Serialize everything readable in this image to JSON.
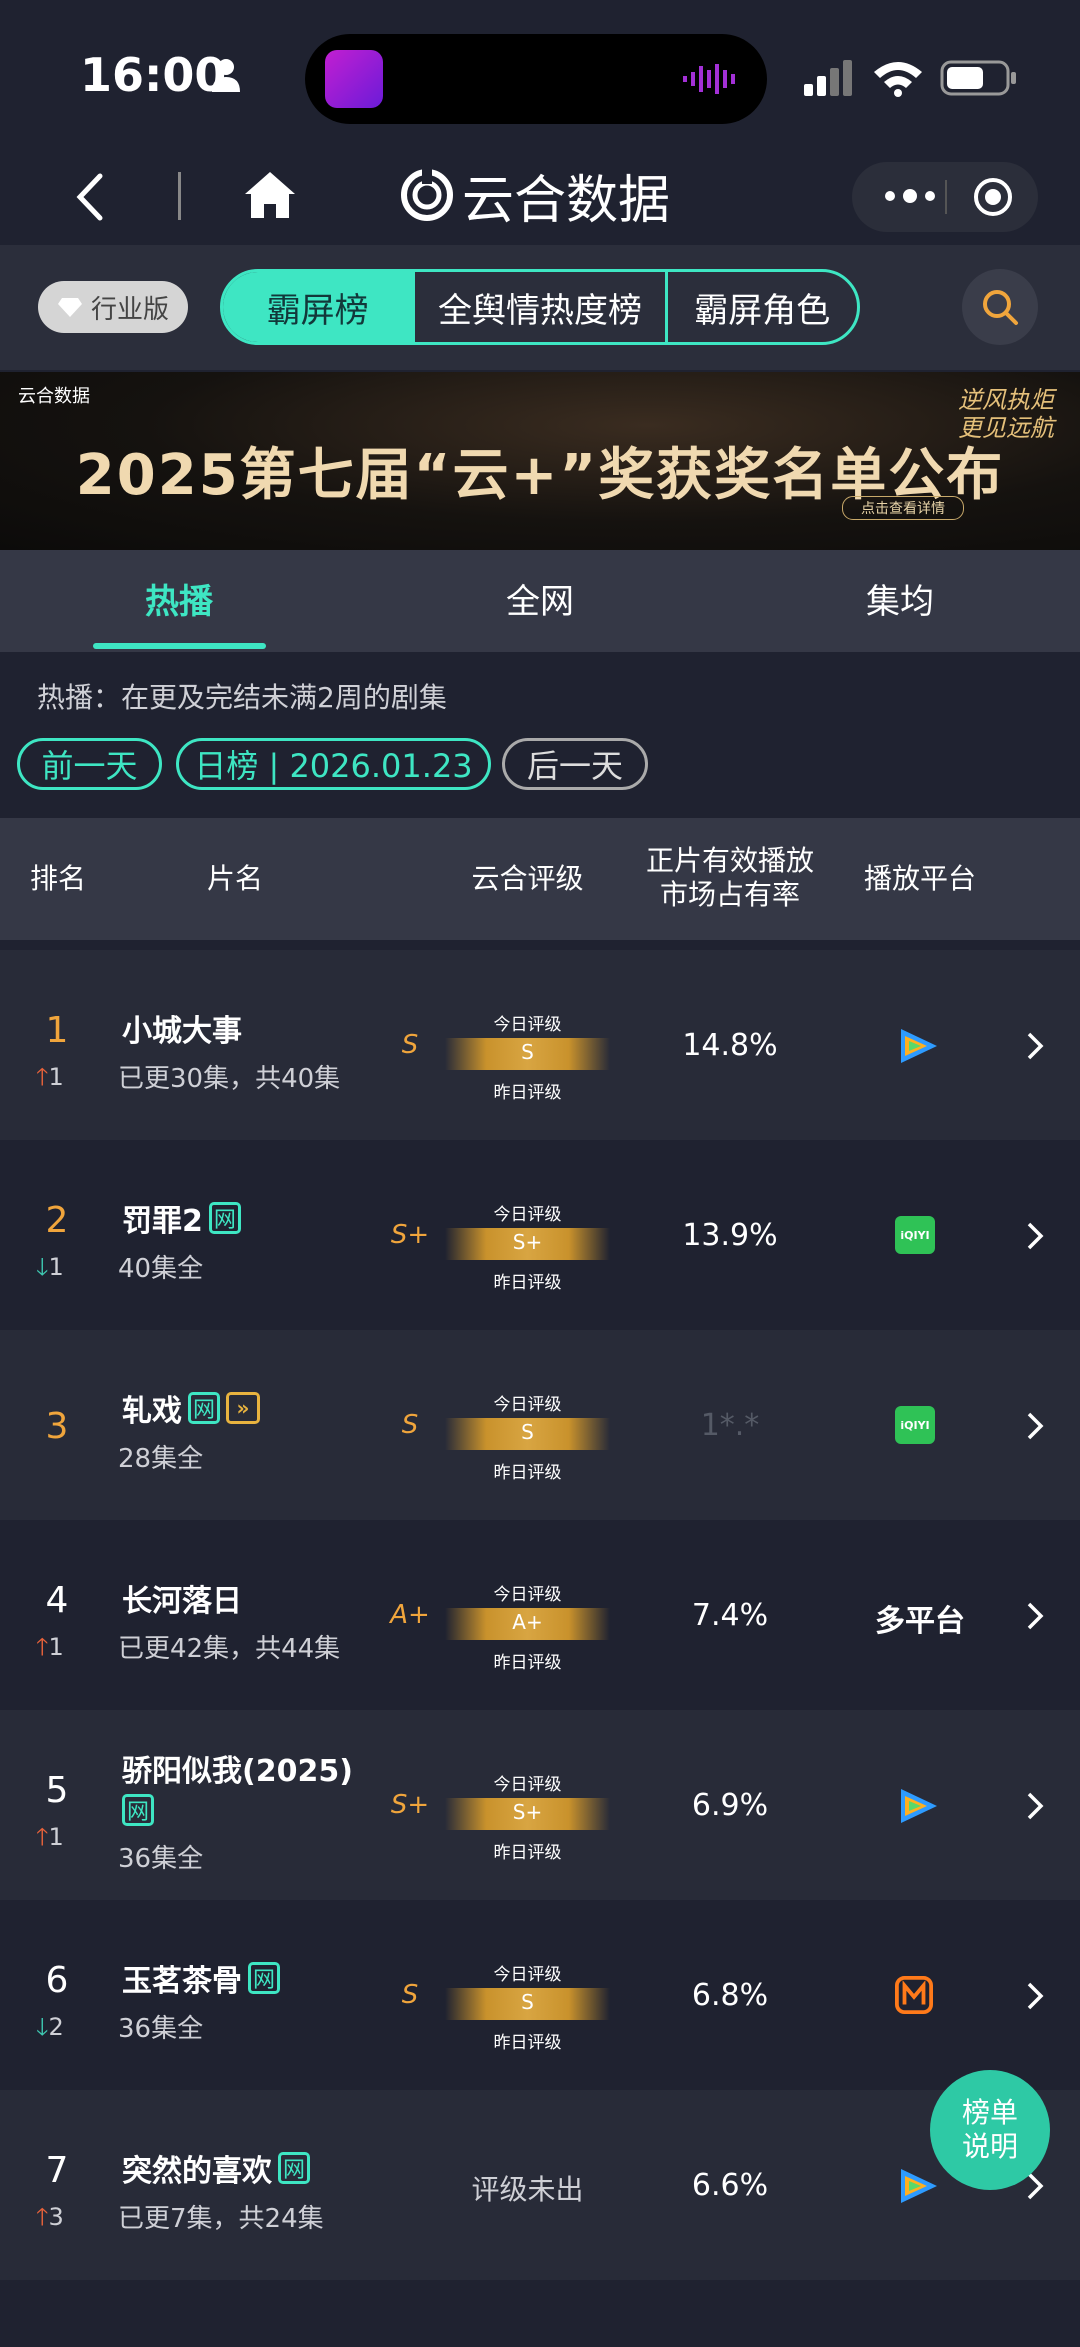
{
  "status": {
    "time": "16:00"
  },
  "nav": {
    "title": "云合数据"
  },
  "topbar": {
    "edition": "行业版",
    "segments": [
      "霸屏榜",
      "全舆情热度榜",
      "霸屏角色"
    ]
  },
  "banner": {
    "logo": "云合数据",
    "title": "2025第七届“云+”奖获奖名单公布",
    "button": "点击查看详情",
    "slogan": "逆风执炬 更见远航"
  },
  "tabs": [
    "热播",
    "全网",
    "集均"
  ],
  "description": "热播：在更及完结未满2周的剧集",
  "date": {
    "prev": "前一天",
    "current": "日榜 | 2026.01.23",
    "next": "后一天"
  },
  "table": {
    "headers": [
      "排名",
      "片名",
      "云合评级",
      "正片有效播放市场占有率",
      "播放平台"
    ],
    "today_label": "今日评级",
    "yesterday_label": "昨日评级",
    "rows": [
      {
        "rank": "1",
        "change": "1",
        "title": "小城大事",
        "episodes": "已更30集，共40集",
        "grade": "S",
        "bar": "S",
        "share": "14.8%",
        "platform": "tencent"
      },
      {
        "rank": "2",
        "change": "1",
        "title": "罚罪2",
        "episodes": "40集全",
        "grade": "S+",
        "bar": "S+",
        "share": "13.9%",
        "platform": "iqiyi"
      },
      {
        "rank": "3",
        "change": "",
        "title": "轧戏",
        "episodes": "28集全",
        "grade": "S",
        "bar": "S",
        "share": "1*.*",
        "platform": "iqiyi"
      },
      {
        "rank": "4",
        "change": "1",
        "title": "长河落日",
        "episodes": "已更42集，共44集",
        "grade": "A+",
        "bar": "A+",
        "share": "7.4%",
        "platform": "多平台"
      },
      {
        "rank": "5",
        "change": "1",
        "title": "骄阳似我(2025)",
        "episodes": "36集全",
        "grade": "S+",
        "bar": "S+",
        "share": "6.9%",
        "platform": "tencent"
      },
      {
        "rank": "6",
        "change": "2",
        "title": "玉茗茶骨",
        "episodes": "36集全",
        "grade": "S",
        "bar": "S",
        "share": "6.8%",
        "platform": "mgtv"
      },
      {
        "rank": "7",
        "change": "3",
        "title": "突然的喜欢",
        "episodes": "已更7集，共24集",
        "grade": "",
        "no_grade": "评级未出",
        "share": "6.6%",
        "platform": "tencent"
      }
    ],
    "tag_w": "网",
    "iqiyi_text": "iQIYI"
  },
  "fab": {
    "line1": "榜单",
    "line2": "说明"
  },
  "colors": {
    "accent": "#3ee6c3",
    "rank": "#f0a53c",
    "up": "#e8623a",
    "down": "#3ec7b0"
  }
}
